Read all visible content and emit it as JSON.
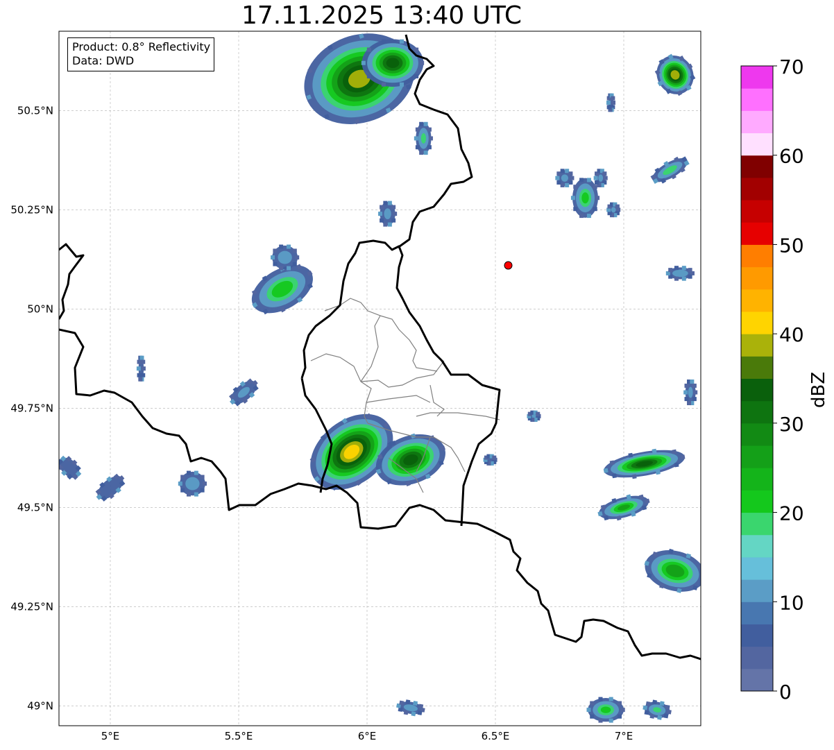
{
  "title": "17.11.2025 13:40 UTC",
  "info": {
    "product": "Product: 0.8° Reflectivity",
    "source": "Data: DWD"
  },
  "map": {
    "lon_range": [
      4.8,
      7.3
    ],
    "lat_range": [
      48.95,
      50.7
    ],
    "lon_ticks": [
      {
        "value": 5.0,
        "label": "5°E"
      },
      {
        "value": 5.5,
        "label": "5.5°E"
      },
      {
        "value": 6.0,
        "label": "6°E"
      },
      {
        "value": 6.5,
        "label": "6.5°E"
      },
      {
        "value": 7.0,
        "label": "7°E"
      }
    ],
    "lat_ticks": [
      {
        "value": 50.5,
        "label": "50.5°N"
      },
      {
        "value": 50.25,
        "label": "50.25°N"
      },
      {
        "value": 50.0,
        "label": "50°N"
      },
      {
        "value": 49.75,
        "label": "49.75°N"
      },
      {
        "value": 49.5,
        "label": "49.5°N"
      },
      {
        "value": 49.25,
        "label": "49.25°N"
      },
      {
        "value": 49.0,
        "label": "49°N"
      }
    ],
    "gridlines": true,
    "radar_site": {
      "lon": 6.55,
      "lat": 50.11,
      "color": "#ff0000"
    }
  },
  "echoes": [
    {
      "lon": 5.97,
      "lat": 50.58,
      "rlon": 0.22,
      "rlat": 0.11,
      "rot": 20,
      "peak": 38
    },
    {
      "lon": 6.1,
      "lat": 50.62,
      "rlon": 0.12,
      "rlat": 0.06,
      "rot": 0,
      "peak": 34
    },
    {
      "lon": 6.22,
      "lat": 50.43,
      "rlon": 0.03,
      "rlat": 0.04,
      "rot": 0,
      "peak": 18
    },
    {
      "lon": 5.67,
      "lat": 50.05,
      "rlon": 0.13,
      "rlat": 0.05,
      "rot": 30,
      "peak": 24
    },
    {
      "lon": 5.68,
      "lat": 50.13,
      "rlon": 0.05,
      "rlat": 0.03,
      "rot": 0,
      "peak": 14
    },
    {
      "lon": 5.94,
      "lat": 49.64,
      "rlon": 0.18,
      "rlat": 0.08,
      "rot": 38,
      "peak": 42
    },
    {
      "lon": 6.17,
      "lat": 49.62,
      "rlon": 0.14,
      "rlat": 0.06,
      "rot": 20,
      "peak": 34
    },
    {
      "lon": 5.52,
      "lat": 49.79,
      "rlon": 0.06,
      "rlat": 0.02,
      "rot": 40,
      "peak": 12
    },
    {
      "lon": 5.32,
      "lat": 49.56,
      "rlon": 0.05,
      "rlat": 0.03,
      "rot": 0,
      "peak": 14
    },
    {
      "lon": 5.0,
      "lat": 49.55,
      "rlon": 0.06,
      "rlat": 0.02,
      "rot": 40,
      "peak": 10
    },
    {
      "lon": 4.84,
      "lat": 49.6,
      "rlon": 0.03,
      "rlat": 0.03,
      "rot": 45,
      "peak": 10
    },
    {
      "lon": 7.2,
      "lat": 50.59,
      "rlon": 0.07,
      "rlat": 0.05,
      "rot": 30,
      "peak": 40
    },
    {
      "lon": 7.18,
      "lat": 50.35,
      "rlon": 0.03,
      "rlat": 0.05,
      "rot": -60,
      "peak": 20
    },
    {
      "lon": 6.85,
      "lat": 50.28,
      "rlon": 0.05,
      "rlat": 0.05,
      "rot": 0,
      "peak": 22
    },
    {
      "lon": 6.77,
      "lat": 50.33,
      "rlon": 0.03,
      "rlat": 0.02,
      "rot": 0,
      "peak": 12
    },
    {
      "lon": 6.91,
      "lat": 50.33,
      "rlon": 0.02,
      "rlat": 0.02,
      "rot": 0,
      "peak": 12
    },
    {
      "lon": 6.96,
      "lat": 50.25,
      "rlon": 0.02,
      "rlat": 0.015,
      "rot": 0,
      "peak": 12
    },
    {
      "lon": 7.22,
      "lat": 50.09,
      "rlon": 0.05,
      "rlat": 0.015,
      "rot": 0,
      "peak": 16
    },
    {
      "lon": 7.08,
      "lat": 49.61,
      "rlon": 0.16,
      "rlat": 0.03,
      "rot": 10,
      "peak": 34
    },
    {
      "lon": 7.0,
      "lat": 49.5,
      "rlon": 0.1,
      "rlat": 0.025,
      "rot": 15,
      "peak": 26
    },
    {
      "lon": 7.2,
      "lat": 49.34,
      "rlon": 0.12,
      "rlat": 0.05,
      "rot": -15,
      "peak": 28
    },
    {
      "lon": 6.93,
      "lat": 48.99,
      "rlon": 0.07,
      "rlat": 0.03,
      "rot": 0,
      "peak": 22
    },
    {
      "lon": 7.13,
      "lat": 48.99,
      "rlon": 0.05,
      "rlat": 0.02,
      "rot": -10,
      "peak": 18
    },
    {
      "lon": 6.17,
      "lat": 48.995,
      "rlon": 0.05,
      "rlat": 0.015,
      "rot": -10,
      "peak": 14
    },
    {
      "lon": 6.08,
      "lat": 50.24,
      "rlon": 0.03,
      "rlat": 0.03,
      "rot": 0,
      "peak": 12
    },
    {
      "lon": 6.65,
      "lat": 49.73,
      "rlon": 0.02,
      "rlat": 0.01,
      "rot": 0,
      "peak": 12
    },
    {
      "lon": 6.48,
      "lat": 49.62,
      "rlon": 0.02,
      "rlat": 0.01,
      "rot": 0,
      "peak": 10
    },
    {
      "lon": 5.12,
      "lat": 49.85,
      "rlon": 0.01,
      "rlat": 0.03,
      "rot": 0,
      "peak": 10
    },
    {
      "lon": 7.26,
      "lat": 49.79,
      "rlon": 0.02,
      "rlat": 0.03,
      "rot": 0,
      "peak": 12
    },
    {
      "lon": 6.95,
      "lat": 50.52,
      "rlon": 0.01,
      "rlat": 0.02,
      "rot": 0,
      "peak": 8
    }
  ],
  "colorbar": {
    "label": "dBZ",
    "min": 0,
    "max": 70,
    "step": 2.5,
    "tick_values": [
      0,
      10,
      20,
      30,
      40,
      50,
      60,
      70
    ],
    "tick_labels": [
      "0",
      "10",
      "20",
      "30",
      "40",
      "50",
      "60",
      "70"
    ],
    "colors": [
      "#6474a8",
      "#5366a0",
      "#415e9e",
      "#4877b0",
      "#5b9dc6",
      "#66bfda",
      "#64d6c4",
      "#3ad66e",
      "#14c81c",
      "#14b41a",
      "#14a018",
      "#128a14",
      "#0e7410",
      "#0a600c",
      "#4a7a0a",
      "#aab20a",
      "#ffd400",
      "#ffb300",
      "#ff9a00",
      "#ff7e00",
      "#e60000",
      "#c60000",
      "#a20000",
      "#800000",
      "#ffe0ff",
      "#ffaaff",
      "#ff70ff",
      "#ee38ee"
    ]
  }
}
